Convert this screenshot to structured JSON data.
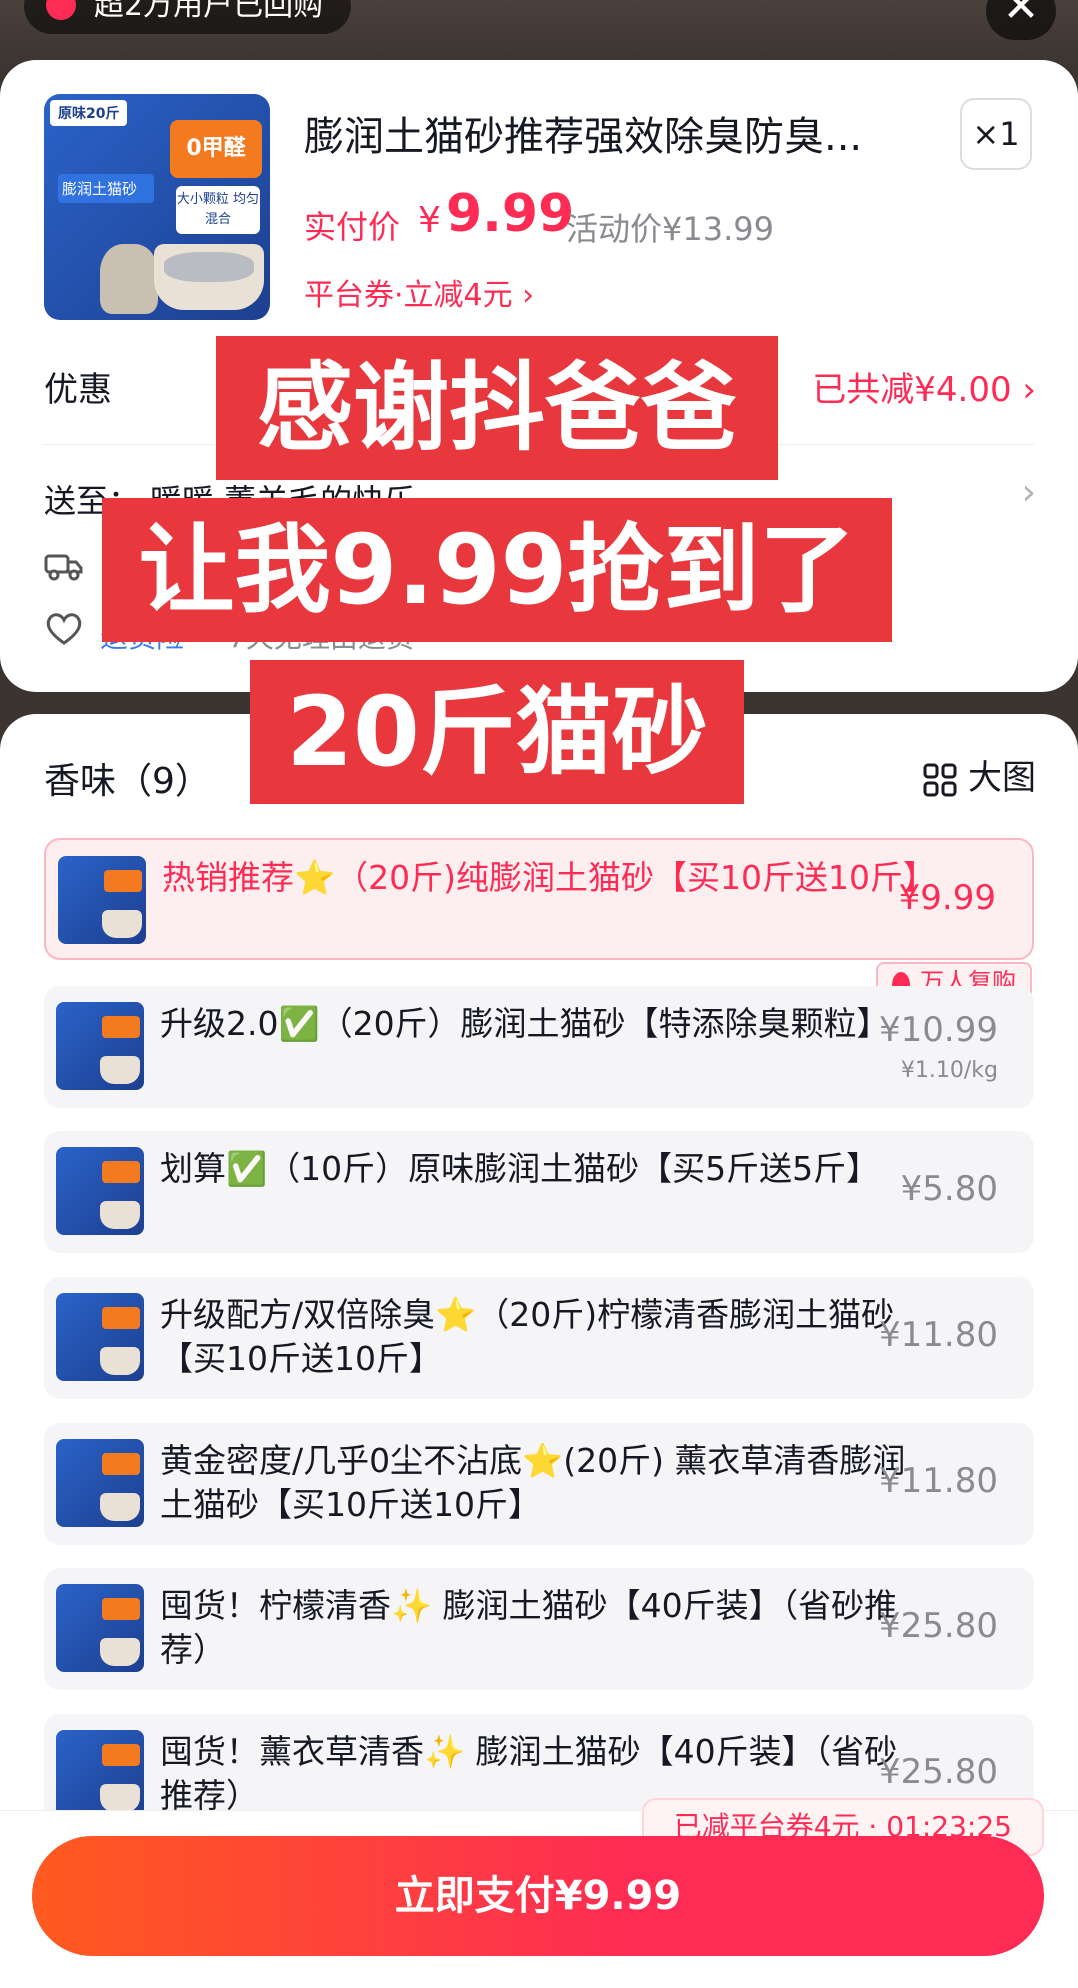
{
  "top": {
    "banner_text": "超2万用户已回购",
    "close_glyph": "✕"
  },
  "product": {
    "title": "膨润土猫砂推荐强效除臭防臭...",
    "quantity": "×1",
    "pay_label": "实付价",
    "pay_symbol": "¥",
    "pay_value": "9.99",
    "activity_price": "活动价¥13.99",
    "coupon_line": "平台券·立减4元 ›",
    "image_tag": "原味20斤",
    "image_badge": "0甲醛",
    "image_note": "大小颗粒 均匀混合",
    "image_bag_title": "膨润土猫砂"
  },
  "discount": {
    "label": "优惠",
    "value": "已共减¥4.00 ›"
  },
  "shipping": {
    "label": "送至：",
    "address": "暖暖 薰羊毛的快乐",
    "arrow": "›"
  },
  "insurance": {
    "label": "退货险",
    "desc": "7天无理由退货"
  },
  "variants_panel": {
    "title": "香味（9）",
    "bigview_label": "大图",
    "items": [
      {
        "name": "热销推荐⭐（20斤)纯膨润土猫砂【买10斤送10斤】",
        "price": "¥9.99",
        "unit": ""
      },
      {
        "name": "升级2.0✅（20斤）膨润土猫砂【特添除臭颗粒】",
        "price": "¥10.99",
        "unit": "¥1.10/kg"
      },
      {
        "name": "划算✅（10斤）原味膨润土猫砂【买5斤送5斤】",
        "price": "¥5.80",
        "unit": ""
      },
      {
        "name": "升级配方/双倍除臭⭐（20斤)柠檬清香膨润土猫砂【买10斤送10斤】",
        "price": "¥11.80",
        "unit": ""
      },
      {
        "name": "黄金密度/几乎0尘不沾底⭐(20斤) 薰衣草清香膨润土猫砂【买10斤送10斤】",
        "price": "¥11.80",
        "unit": ""
      },
      {
        "name": "囤货！柠檬清香✨ 膨润土猫砂【40斤装】（省砂推荐）",
        "price": "¥25.80",
        "unit": ""
      },
      {
        "name": "囤货！薰衣草清香✨ 膨润土猫砂【40斤装】（省砂推荐）",
        "price": "¥25.80",
        "unit": ""
      }
    ],
    "rebuy_badge": "万人复购"
  },
  "footer": {
    "coupon_timer": "已减平台券4元 · 01:23:25",
    "pay_button": "立即支付¥9.99"
  },
  "captions": {
    "line1": "感谢抖爸爸",
    "line2": "让我9.99抢到了",
    "line3": "20斤猫砂"
  },
  "colors": {
    "accent": "#fe2c55",
    "caption_bg": "#e8373d",
    "link_blue": "#3b7ae8"
  }
}
